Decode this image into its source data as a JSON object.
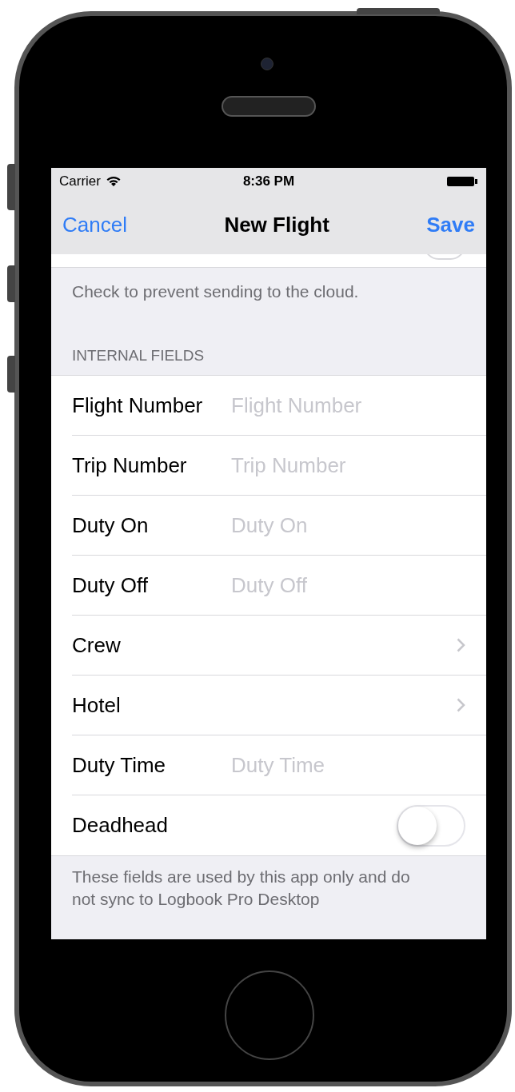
{
  "status_bar": {
    "carrier": "Carrier",
    "time": "8:36 PM"
  },
  "nav": {
    "cancel": "Cancel",
    "title": "New Flight",
    "save": "Save"
  },
  "previous_section": {
    "switch_on": false,
    "footer": "Check to prevent sending to the cloud."
  },
  "section": {
    "header": "INTERNAL FIELDS",
    "rows": [
      {
        "kind": "field",
        "label": "Flight Number",
        "placeholder": "Flight Number"
      },
      {
        "kind": "field",
        "label": "Trip Number",
        "placeholder": "Trip Number"
      },
      {
        "kind": "field",
        "label": "Duty On",
        "placeholder": "Duty On"
      },
      {
        "kind": "field",
        "label": "Duty Off",
        "placeholder": "Duty Off"
      },
      {
        "kind": "link",
        "label": "Crew"
      },
      {
        "kind": "link",
        "label": "Hotel"
      },
      {
        "kind": "field",
        "label": "Duty Time",
        "placeholder": "Duty Time"
      },
      {
        "kind": "switch",
        "label": "Deadhead",
        "on": false
      }
    ],
    "footer": "These fields are used by this app only and do not sync to Logbook Pro Desktop"
  }
}
